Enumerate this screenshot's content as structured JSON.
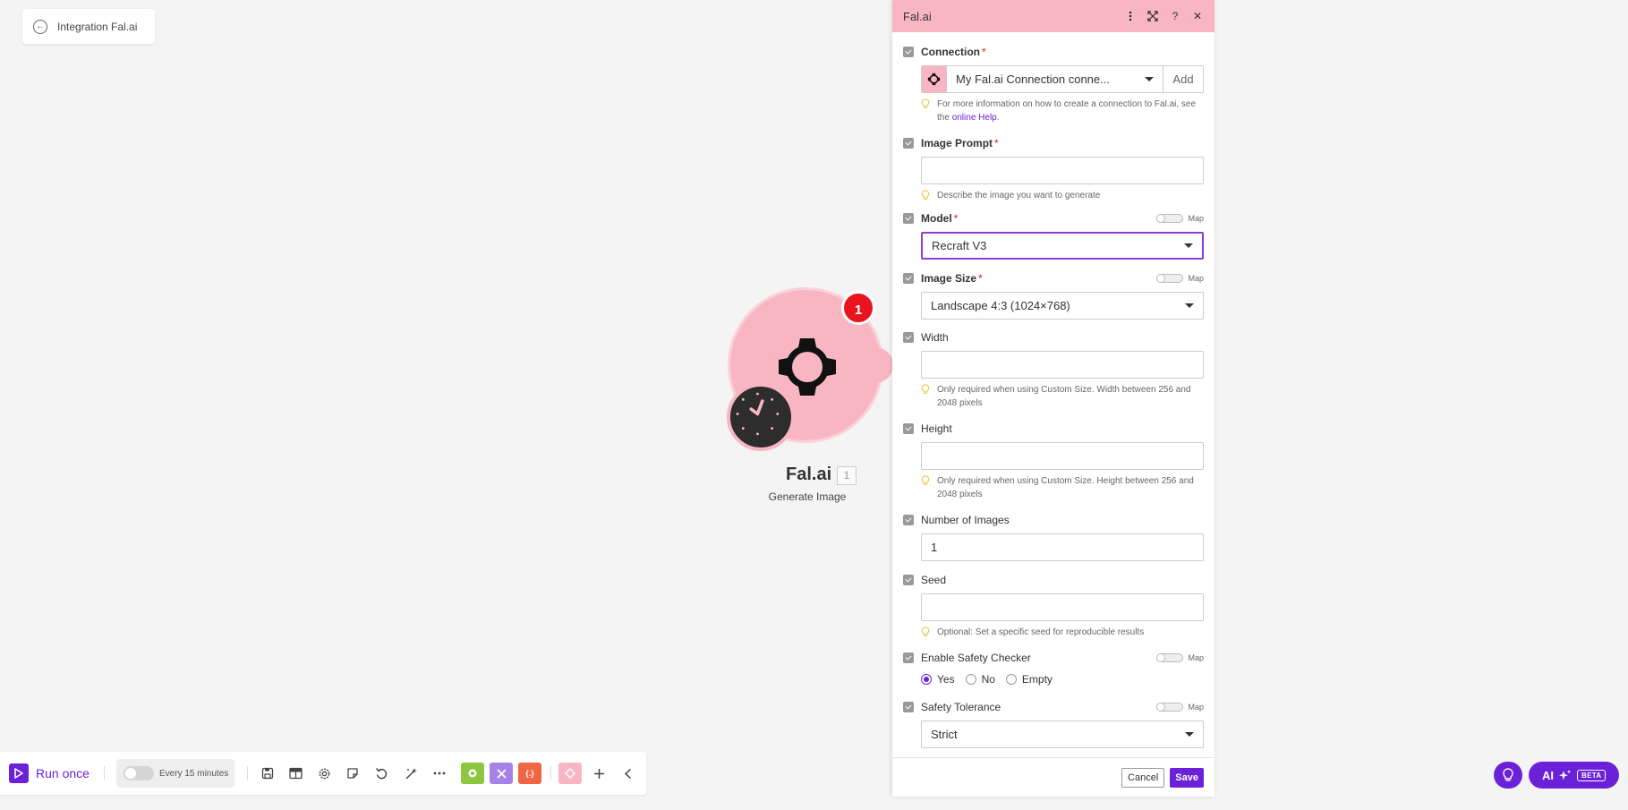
{
  "breadcrumb": {
    "label": "Integration Fal.ai"
  },
  "module": {
    "name": "Fal.ai",
    "number": "1",
    "action": "Generate Image",
    "badge": "1"
  },
  "toolbar": {
    "run_label": "Run once",
    "schedule_label": "Every 15 minutes",
    "icons": [
      "save-icon",
      "table-icon",
      "settings-icon",
      "notes-icon",
      "undo-icon",
      "magic-wand-icon",
      "more-icon"
    ],
    "chips": [
      {
        "name": "falai-chip",
        "label": "",
        "color": "#8dc63f"
      },
      {
        "name": "tools-chip",
        "label": "",
        "color": "#a682e8"
      },
      {
        "name": "flow-control-chip",
        "label": "{.}",
        "color": "#f06543"
      },
      {
        "name": "text-parser-chip",
        "label": "",
        "color": "#f8b6c3"
      }
    ]
  },
  "ai_button": {
    "label": "AI",
    "beta": "BETA"
  },
  "panel": {
    "title": "Fal.ai",
    "header_color": "#f8b6c3",
    "connection": {
      "label": "Connection",
      "value": "My Fal.ai Connection conne...",
      "add_label": "Add",
      "hint_prefix": "For more information on how to create a connection to Fal.ai, see the ",
      "hint_link": "online Help",
      "hint_suffix": "."
    },
    "image_prompt": {
      "label": "Image Prompt",
      "value": "",
      "hint": "Describe the image you want to generate"
    },
    "model": {
      "label": "Model",
      "value": "Recraft V3",
      "map": "Map"
    },
    "image_size": {
      "label": "Image Size",
      "value": "Landscape 4:3 (1024×768)",
      "map": "Map"
    },
    "width": {
      "label": "Width",
      "value": "",
      "hint": "Only required when using Custom Size. Width between 256 and 2048 pixels"
    },
    "height": {
      "label": "Height",
      "value": "",
      "hint": "Only required when using Custom Size. Height between 256 and 2048 pixels"
    },
    "num_images": {
      "label": "Number of Images",
      "value": "1"
    },
    "seed": {
      "label": "Seed",
      "value": "",
      "hint": "Optional: Set a specific seed for reproducible results"
    },
    "safety_checker": {
      "label": "Enable Safety Checker",
      "map": "Map",
      "options": [
        "Yes",
        "No",
        "Empty"
      ],
      "selected": "Yes"
    },
    "safety_tolerance": {
      "label": "Safety Tolerance",
      "value": "Strict",
      "map": "Map"
    },
    "required_mark": "*",
    "cancel_label": "Cancel",
    "save_label": "Save"
  }
}
